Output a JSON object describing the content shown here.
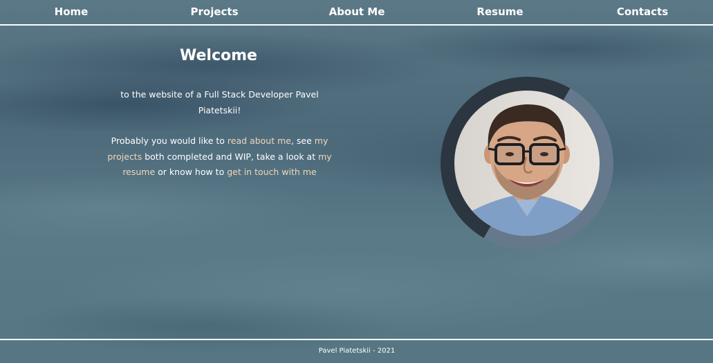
{
  "nav": {
    "items": [
      {
        "label": "Home"
      },
      {
        "label": "Projects"
      },
      {
        "label": "About Me"
      },
      {
        "label": "Resume"
      },
      {
        "label": "Contacts"
      }
    ]
  },
  "main": {
    "title": "Welcome",
    "intro_line": "to the website of a Full Stack Developer Pavel Piatetskii!",
    "para_prefix": "Probably you would like to ",
    "link_about": "read about me",
    "sep_see": ", see ",
    "link_projects": "my projects",
    "mid_text": " both completed and WIP, take a look at ",
    "link_resume": "my resume",
    "or_text": " or know how to ",
    "link_contact": "get in touch with me"
  },
  "colors": {
    "link": "#f2d7b8",
    "ring_light": "#66798c",
    "ring_dark": "#2c3640"
  },
  "footer": {
    "text": "Pavel Piatetskii - 2021"
  }
}
